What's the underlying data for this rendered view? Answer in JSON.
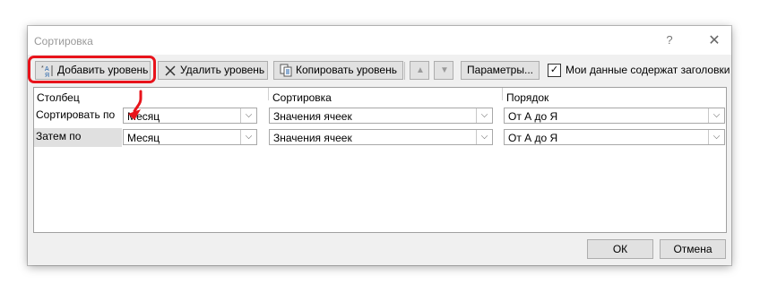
{
  "window": {
    "title": "Сортировка",
    "help": "?",
    "close": "✕"
  },
  "toolbar": {
    "add_level": "Добавить уровень",
    "delete_level": "Удалить уровень",
    "copy_level": "Копировать уровень",
    "params": "Параметры...",
    "has_headers_label": "Мои данные содержат заголовки",
    "has_headers_checked": true
  },
  "grid": {
    "headers": {
      "column": "Столбец",
      "sort": "Сортировка",
      "order": "Порядок"
    },
    "rows": [
      {
        "label": "Сортировать по",
        "column": "Месяц",
        "sort_on": "Значения ячеек",
        "order": "От А до Я"
      },
      {
        "label": "Затем по",
        "column": "Месяц",
        "sort_on": "Значения ячеек",
        "order": "От А до Я"
      }
    ]
  },
  "footer": {
    "ok": "ОК",
    "cancel": "Отмена"
  },
  "colors": {
    "highlight": "#e8131b",
    "dialog_bg": "#f0f0f0",
    "button_bg": "#e1e1e1"
  }
}
